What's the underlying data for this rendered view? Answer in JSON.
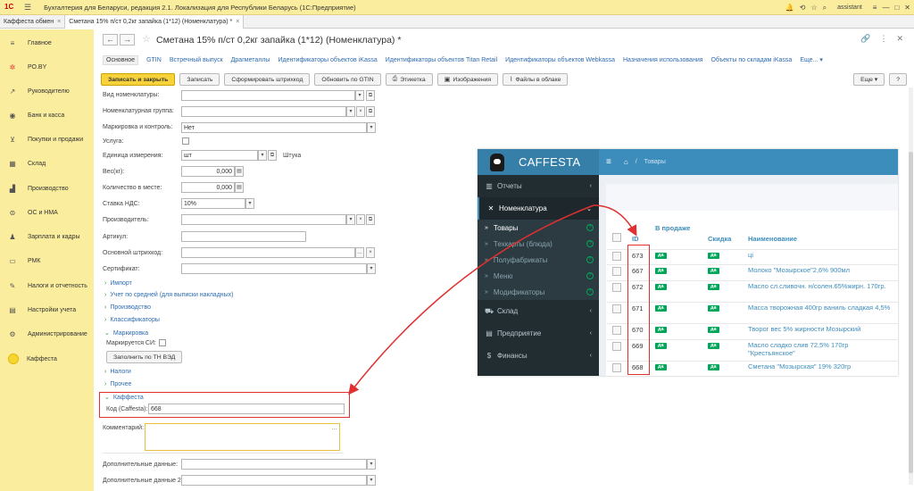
{
  "titlebar": {
    "logo": "1С",
    "title": "Бухгалтерия для Беларуси, редакция 2.1. Локализация для Республики Беларусь   (1С:Предприятие)",
    "user": "assistant"
  },
  "window_tabs": [
    {
      "label": "Каффеста обмен"
    },
    {
      "label": "Сметана 15% п/ст 0,2кг запайка (1*12) (Номенклатура) *"
    }
  ],
  "sidebar": {
    "items": [
      {
        "label": "Главное",
        "icon": "menu-icon"
      },
      {
        "label": "РО.BY",
        "icon": "ro-icon"
      },
      {
        "label": "Руководителю",
        "icon": "chart-icon"
      },
      {
        "label": "Банк и касса",
        "icon": "bank-icon"
      },
      {
        "label": "Покупки и продажи",
        "icon": "cart-icon"
      },
      {
        "label": "Склад",
        "icon": "warehouse-icon"
      },
      {
        "label": "Производство",
        "icon": "factory-icon"
      },
      {
        "label": "ОС и НМА",
        "icon": "assets-icon"
      },
      {
        "label": "Зарплата и кадры",
        "icon": "people-icon"
      },
      {
        "label": "РМК",
        "icon": "pos-icon"
      },
      {
        "label": "Налоги и отчетность",
        "icon": "taxes-icon"
      },
      {
        "label": "Настройки учета",
        "icon": "settings-icon"
      },
      {
        "label": "Администрирование",
        "icon": "gear-icon"
      },
      {
        "label": "Каффеста",
        "icon": "caffesta-dot-icon"
      }
    ]
  },
  "form": {
    "title": "Сметана 15% п/ст 0,2кг запайка (1*12) (Номенклатура) *",
    "tabs": [
      "Основное",
      "GTIN",
      "Встречный выпуск",
      "Драгметаллы",
      "Идентификаторы объектов iKassa",
      "Идентификаторы объектов Titan Retail",
      "Идентификаторы объектов Webkassa",
      "Назначения использования",
      "Объекты по складам iKassa",
      "Еще..."
    ],
    "toolbar": {
      "save_close": "Записать и закрыть",
      "save": "Записать",
      "gen_barcode": "Сформировать штрихкод",
      "update_gtin": "Обновить по GTIN",
      "label": "Этикетка",
      "images": "Изображения",
      "cloud_files": "Файлы в облаке",
      "more": "Еще",
      "help": "?"
    },
    "fields": {
      "nom_type": {
        "label": "Вид номенклатуры:",
        "value": ""
      },
      "nom_group": {
        "label": "Номенклатурная группа:",
        "value": ""
      },
      "marking": {
        "label": "Маркировка и контроль:",
        "value": "Нет"
      },
      "service": {
        "label": "Услуга:"
      },
      "unit": {
        "label": "Единица измерения:",
        "value": "шт",
        "unit_name": "Штука"
      },
      "weight": {
        "label": "Вес(кг):",
        "value": "0,000"
      },
      "qty_place": {
        "label": "Количество в месте:",
        "value": "0,000"
      },
      "vat": {
        "label": "Ставка НДС:",
        "value": "10%"
      },
      "producer": {
        "label": "Производитель:",
        "value": ""
      },
      "article": {
        "label": "Артикул:",
        "value": ""
      },
      "barcode": {
        "label": "Основной штрихкод:",
        "value": ""
      },
      "certificate": {
        "label": "Сертификат:",
        "value": ""
      }
    },
    "groups": {
      "import": "Импорт",
      "avg_accounting": "Учет по средней (для выписки накладных)",
      "production": "Производство",
      "classifiers": "Классификаторы",
      "marking": "Маркировка",
      "marked_si": "Маркируется СИ:",
      "fill_tnved": "Заполнить по ТН ВЭД",
      "taxes": "Налоги",
      "other": "Прочее",
      "caffesta": "Каффеста",
      "caffesta_code_label": "Код (Caffesta):",
      "caffesta_code_value": "668"
    },
    "comment_label": "Комментарий:",
    "extra1_label": "Дополнительные данные:",
    "extra2_label": "Дополнительные данные 2:"
  },
  "caffesta": {
    "brand": "CAFFESTA",
    "crumb": "Товары",
    "menu": [
      {
        "label": "Отчеты",
        "icon": "reports-icon"
      },
      {
        "label": "Номенклатура",
        "icon": "cutlery-icon"
      }
    ],
    "submenu": [
      {
        "label": "Товары"
      },
      {
        "label": "Техкарты (блюда)"
      },
      {
        "label": "Полуфабрикаты"
      },
      {
        "label": "Меню"
      },
      {
        "label": "Модификаторы"
      }
    ],
    "menu_bottom": [
      {
        "label": "Склад",
        "icon": "truck-icon"
      },
      {
        "label": "Предприятие",
        "icon": "building-icon"
      },
      {
        "label": "Финансы",
        "icon": "finance-icon"
      }
    ],
    "table": {
      "headers": {
        "id": "ID",
        "on_sale": "В продаже",
        "discount": "Скидка",
        "name": "Наименование"
      },
      "rows": [
        {
          "id": "673",
          "on_sale": "да",
          "discount": "да",
          "name": "ці"
        },
        {
          "id": "667",
          "on_sale": "да",
          "discount": "да",
          "name": "Молоко \"Мозырское\"2,6% 900мл"
        },
        {
          "id": "672",
          "on_sale": "да",
          "discount": "да",
          "name": "Масло сл.сливочн. н/солен.65%жирн. 170гр."
        },
        {
          "id": "671",
          "on_sale": "да",
          "discount": "да",
          "name": "Масса творожная 400гр ваниль сладкая 4,5%"
        },
        {
          "id": "670",
          "on_sale": "да",
          "discount": "да",
          "name": "Творог вес 5% жирности Мозырский"
        },
        {
          "id": "669",
          "on_sale": "да",
          "discount": "да",
          "name": "Масло сладко слив 72,5% 170гр \"Крестьянское\""
        },
        {
          "id": "668",
          "on_sale": "да",
          "discount": "да",
          "name": "Сметана \"Мозырская\" 19% 320гр"
        }
      ]
    }
  },
  "colors": {
    "sidebar_bg": "#fbed9e",
    "primary_button": "#f8d23a",
    "caffesta_header": "#3c8dbc",
    "caffesta_sidebar": "#222d32",
    "badge_green": "#00a65a",
    "highlight_red": "#e03030"
  }
}
